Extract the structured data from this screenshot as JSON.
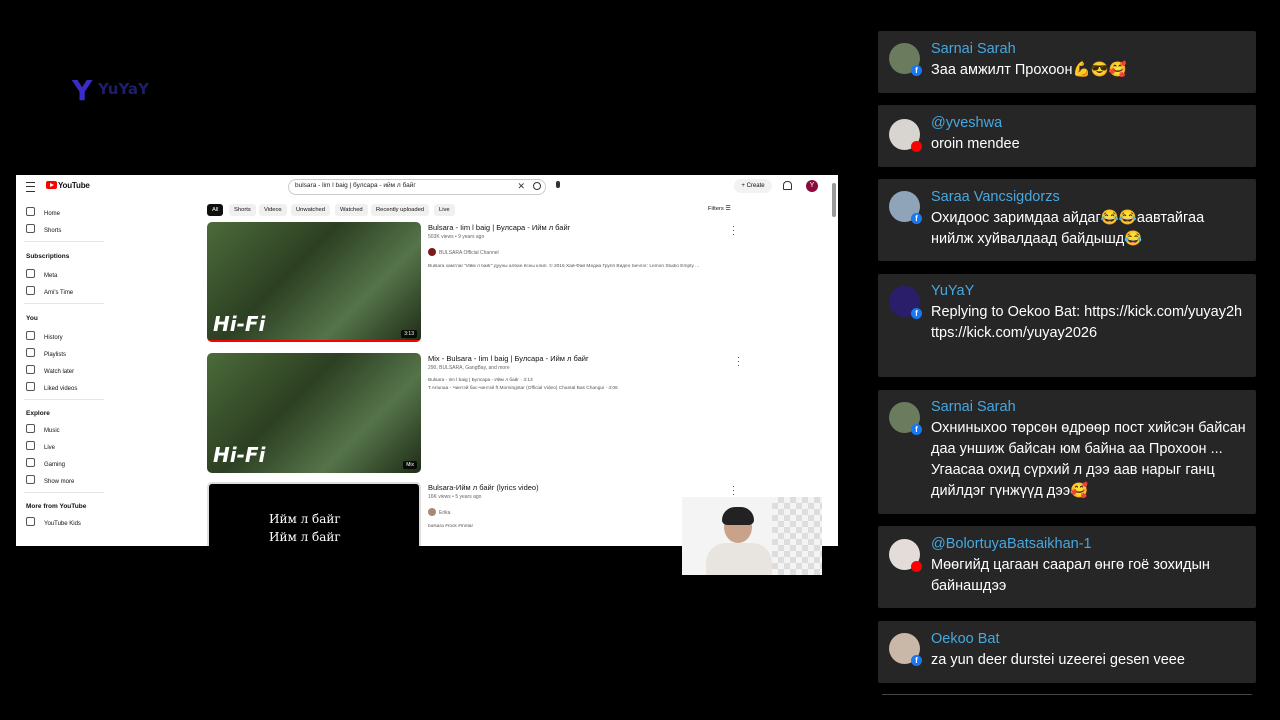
{
  "stream_logo": {
    "mark": "Y",
    "text": "YuYaY"
  },
  "youtube": {
    "brand": "YouTube",
    "search_query": "bulsara - lim l baig | булсара - ийм л байг",
    "create_label": "Create",
    "avatar_letter": "Y",
    "sidebar": {
      "main": [
        {
          "label": "Home",
          "icon": "home-icon"
        },
        {
          "label": "Shorts",
          "icon": "shorts-icon"
        }
      ],
      "subscriptions_header": "Subscriptions",
      "subscriptions": [
        {
          "label": "Meta"
        },
        {
          "label": "Ami's Time"
        }
      ],
      "you_header": "You",
      "you": [
        {
          "label": "History"
        },
        {
          "label": "Playlists"
        },
        {
          "label": "Watch later"
        },
        {
          "label": "Liked videos"
        }
      ],
      "explore_header": "Explore",
      "explore": [
        {
          "label": "Music"
        },
        {
          "label": "Live"
        },
        {
          "label": "Gaming"
        },
        {
          "label": "Show more"
        }
      ],
      "more_header": "More from YouTube",
      "more": [
        {
          "label": "YouTube Kids"
        }
      ]
    },
    "chips": [
      "All",
      "Shorts",
      "Videos",
      "Unwatched",
      "Watched",
      "Recently uploaded",
      "Live"
    ],
    "filters_label": "Filters",
    "videos": [
      {
        "title": "Bulsara - Iim l baig | Булсара - Ийм л байг",
        "meta": "503K views • 9 years ago",
        "channel": "BULSARA Official Channel",
        "desc": "Bulsara хамтлаг \"Ийм л байг\" дууны албан ёсны клип. © 2016 Хай-Фай Медиа Групп Видео бичлэг: Lemon Studio Empty ...",
        "duration": "3:13",
        "thumb_text": "Hi-Fi"
      },
      {
        "title": "Mix - Bulsara - Iim l baig | Булсара - Ийм л байг",
        "meta": "290, BULSARA, GangBay, and more",
        "line1": "Bulsara - Iim l baig | Булсара - Ийм л байг · 3:13",
        "line2": "T.Ariunaa - Чинтэй бас-чинтэй ft Morningstar (Official Video) Chantal Bas Changui · 4:06",
        "duration": "Mix",
        "thumb_text": "Hi-Fi"
      },
      {
        "title": "Bulsara-Ийм л байг (lyrics video)",
        "meta": "16K views • 5 years ago",
        "channel": "Erika",
        "desc": "bulsara #rock #mntar",
        "lyric1": "Ийм л байг",
        "lyric2": "Ийм л байг"
      }
    ]
  },
  "chat": [
    {
      "name": "Sarnai Sarah",
      "text": "Заа амжилт Прохоон💪😎🥰",
      "platform": "facebook"
    },
    {
      "name": "@yveshwa",
      "text": "oroin mendee",
      "platform": "youtube"
    },
    {
      "name": "Saraa Vancsigdorzs",
      "text": "Охидоос заримдаа айдаг😂😂аавтайгаа нийлж хуйвалдаад байдышд😂",
      "platform": "facebook"
    },
    {
      "name": "YuYaY",
      "text": "Replying to Oekoo Bat: https://kick.com/yuyay2https://kick.com/yuyay2026",
      "platform": "facebook"
    },
    {
      "name": "Sarnai Sarah",
      "text": "Охниныхоо төрсөн өдрөөр пост хийсэн байсан даа уншиж байсан юм байна аа Прохоон ... Угаасаа охид сүрхий л дээ аав нарыг ганц дийлдэг гүнжүүд дээ🥰",
      "platform": "facebook"
    },
    {
      "name": "@BolortuyaBatsaikhan-1",
      "text": "Мөөгийд цагаан саарал өнгө гоё зохидын байнашдээ",
      "platform": "youtube"
    },
    {
      "name": "Oekoo Bat",
      "text": "za yun deer durstei uzeerei gesen veee",
      "platform": "facebook"
    }
  ]
}
